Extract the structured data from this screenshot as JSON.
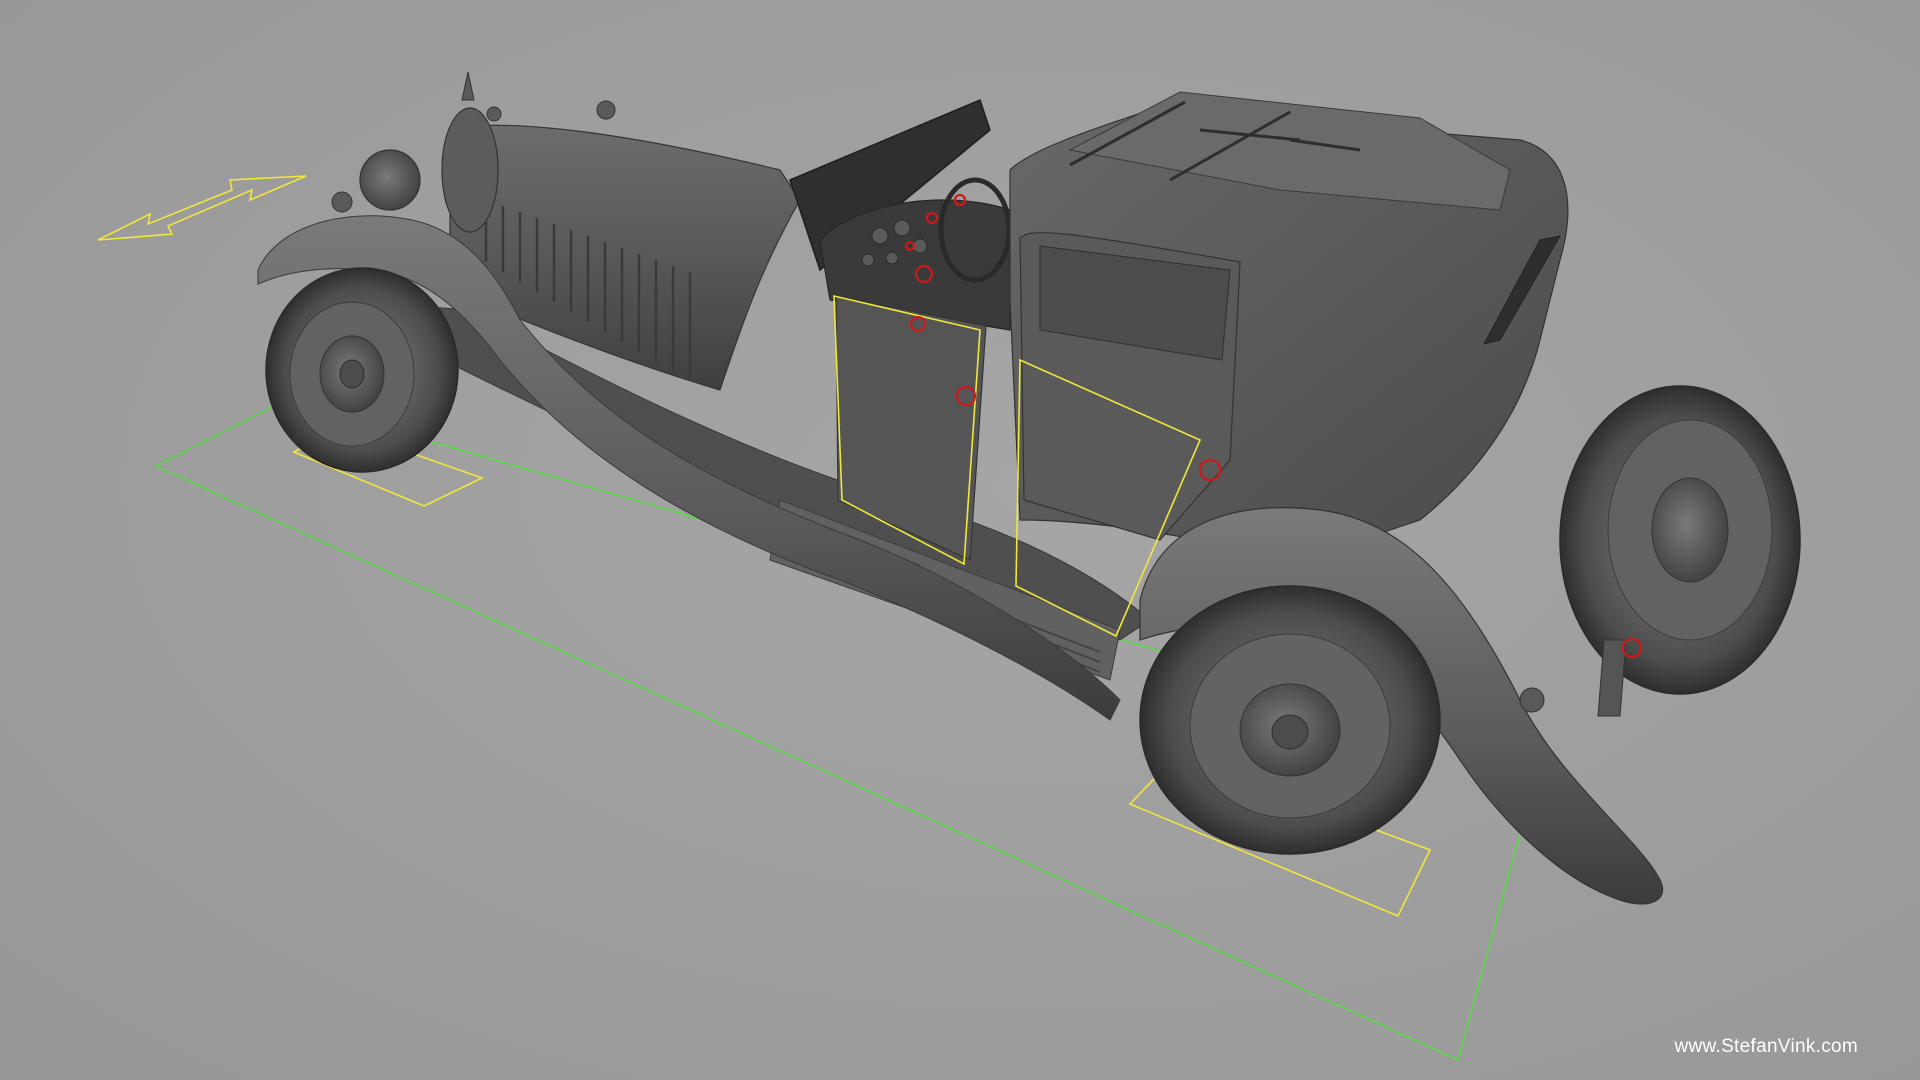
{
  "viewport": {
    "background": "#9e9e9e",
    "model": "vintage-roadster-coupe",
    "render_mode": "grey-shaded"
  },
  "gizmos": {
    "move_arrow_color": "#f0e63c",
    "wheel_pads_color": "#f0e63c",
    "door_hinge_box_color": "#f0e63c",
    "ground_frame_color": "#5cd84a",
    "pivot_markers_color": "#d01818"
  },
  "watermark": {
    "text": "www.StefanVink.com"
  }
}
